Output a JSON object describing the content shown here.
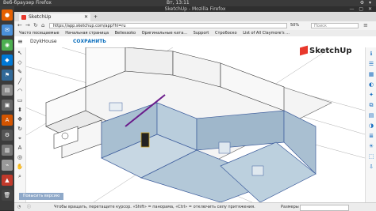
{
  "system": {
    "menu": "Веб-браузер Firefox",
    "clock": "Вт, 13:11",
    "tray": "⚙ ▾"
  },
  "window": {
    "title": "SketchUp - Mozilla Firefox"
  },
  "tabs": [
    {
      "label": "SketchUp"
    }
  ],
  "nav": {
    "url": "https://app.sketchup.com/app?hl=ru",
    "zoom": "50%",
    "search_placeholder": "Поиск"
  },
  "bookmarks": [
    "Часто посещаемые",
    "Начальная страница",
    "Beliessoko",
    "Оригинальные ката...",
    "Support",
    "Стробоско",
    "List of All Claymore's ..."
  ],
  "app": {
    "project_name": "DzykHouse",
    "save_label": "СОХРАНИТЬ",
    "logo_text": "SketchUp",
    "version_button": "Повысить версию"
  },
  "status": {
    "hint": "Чтобы вращать, перетащите курсор. «Shift» = панорама, «Ctrl» = отключить силу притяжения.",
    "measure_label": "Размеры"
  },
  "colors": {
    "accent": "#e8382c",
    "wall_fill": "#a8bfd1",
    "selection": "#3d5d9c",
    "purple_edge": "#6a1b8a"
  }
}
